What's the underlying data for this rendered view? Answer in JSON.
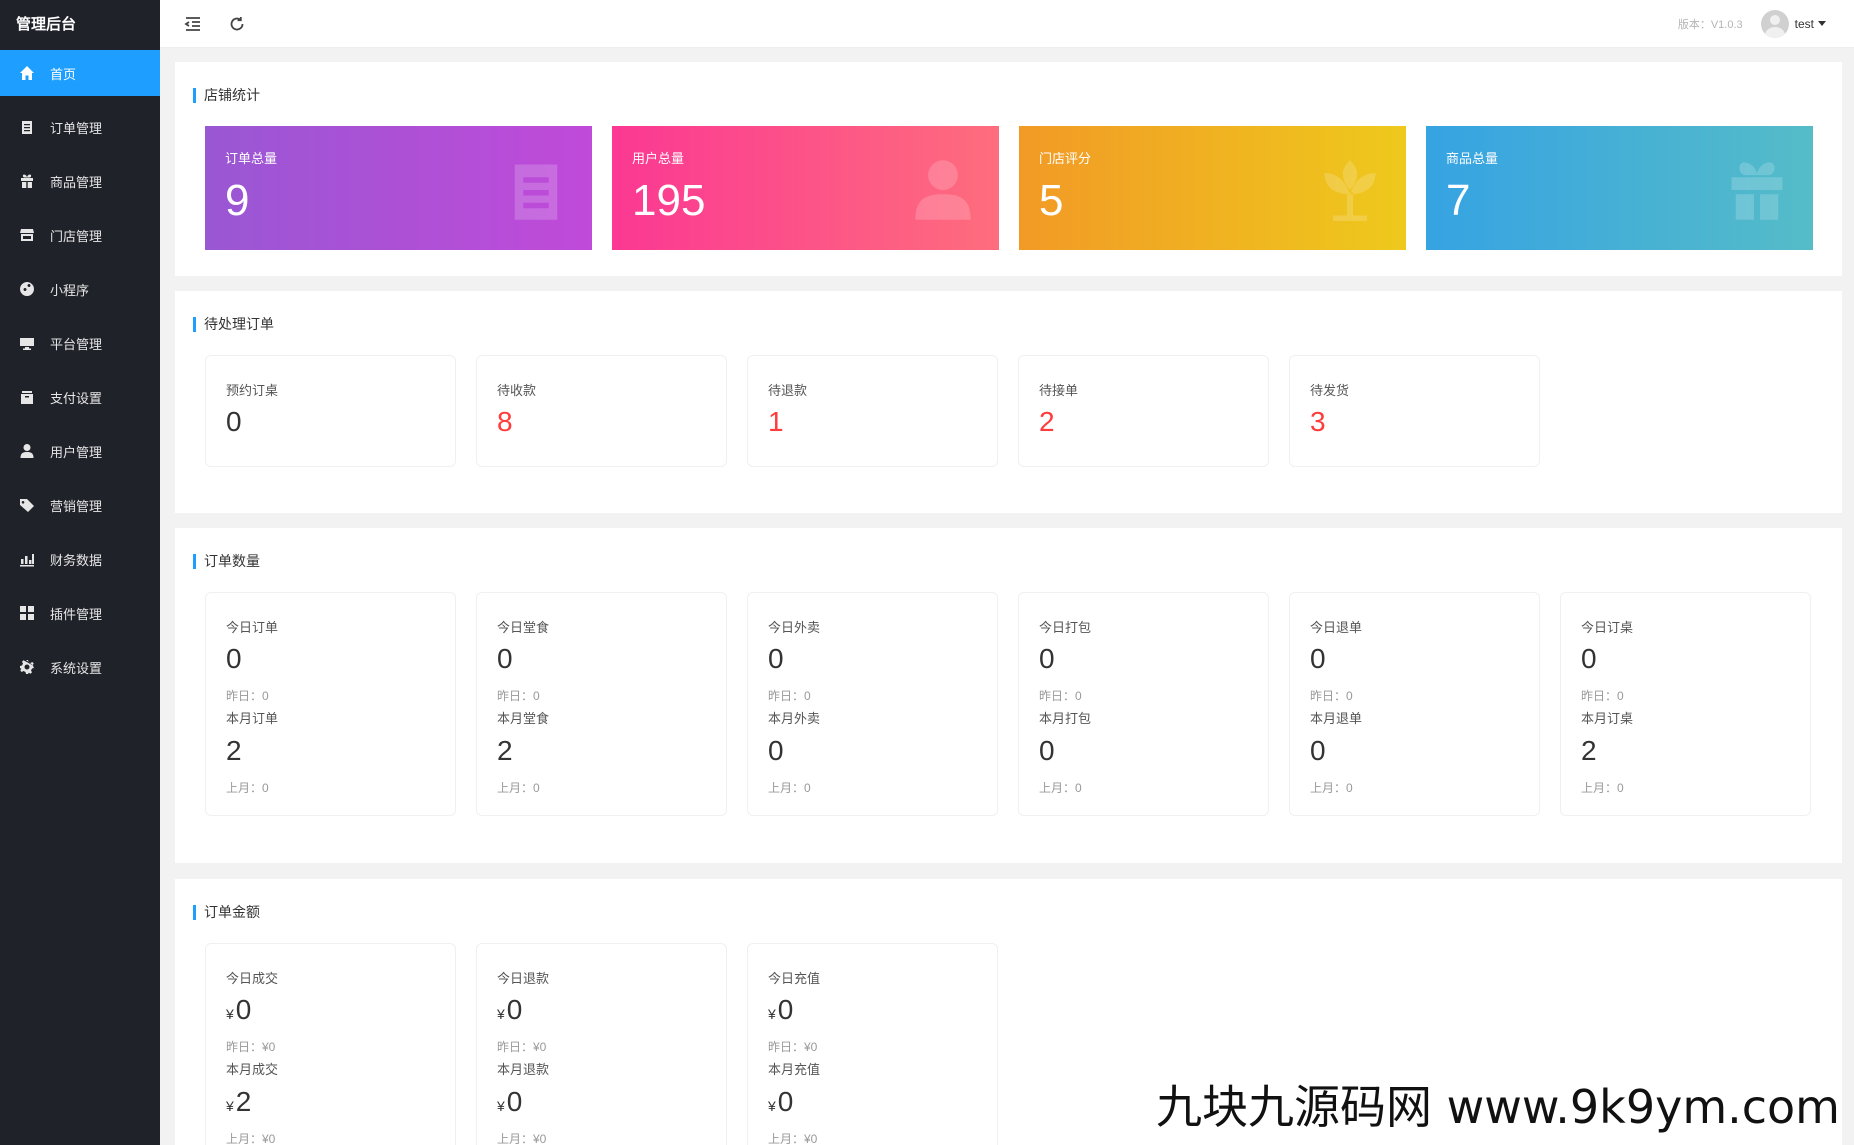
{
  "app": {
    "title": "管理后台"
  },
  "sidebar": {
    "items": [
      {
        "label": "首页",
        "icon": "home-icon",
        "active": true
      },
      {
        "label": "订单管理",
        "icon": "clipboard-icon"
      },
      {
        "label": "商品管理",
        "icon": "gift-icon"
      },
      {
        "label": "门店管理",
        "icon": "store-icon"
      },
      {
        "label": "小程序",
        "icon": "mini-program-icon"
      },
      {
        "label": "平台管理",
        "icon": "monitor-icon"
      },
      {
        "label": "支付设置",
        "icon": "wallet-icon"
      },
      {
        "label": "用户管理",
        "icon": "user-icon"
      },
      {
        "label": "营销管理",
        "icon": "tag-icon"
      },
      {
        "label": "财务数据",
        "icon": "bar-chart-icon"
      },
      {
        "label": "插件管理",
        "icon": "grid-icon"
      },
      {
        "label": "系统设置",
        "icon": "gear-icon"
      }
    ]
  },
  "header": {
    "version": "版本：V1.0.3",
    "username": "test"
  },
  "store_stats": {
    "title": "店铺统计",
    "cards": [
      {
        "label": "订单总量",
        "value": "9",
        "icon": "clipboard-icon"
      },
      {
        "label": "用户总量",
        "value": "195",
        "icon": "user-icon"
      },
      {
        "label": "门店评分",
        "value": "5",
        "icon": "flower-icon"
      },
      {
        "label": "商品总量",
        "value": "7",
        "icon": "gift-icon"
      }
    ]
  },
  "pending_orders": {
    "title": "待处理订单",
    "items": [
      {
        "label": "预约订桌",
        "value": "0"
      },
      {
        "label": "待收款",
        "value": "8"
      },
      {
        "label": "待退款",
        "value": "1"
      },
      {
        "label": "待接单",
        "value": "2"
      },
      {
        "label": "待发货",
        "value": "3"
      }
    ]
  },
  "order_counts": {
    "title": "订单数量",
    "items": [
      {
        "today_label": "今日订单",
        "today": "0",
        "yesterday": "昨日：0",
        "month_label": "本月订单",
        "month": "2",
        "last_month": "上月：0"
      },
      {
        "today_label": "今日堂食",
        "today": "0",
        "yesterday": "昨日：0",
        "month_label": "本月堂食",
        "month": "2",
        "last_month": "上月：0"
      },
      {
        "today_label": "今日外卖",
        "today": "0",
        "yesterday": "昨日：0",
        "month_label": "本月外卖",
        "month": "0",
        "last_month": "上月：0"
      },
      {
        "today_label": "今日打包",
        "today": "0",
        "yesterday": "昨日：0",
        "month_label": "本月打包",
        "month": "0",
        "last_month": "上月：0"
      },
      {
        "today_label": "今日退单",
        "today": "0",
        "yesterday": "昨日：0",
        "month_label": "本月退单",
        "month": "0",
        "last_month": "上月：0"
      },
      {
        "today_label": "今日订桌",
        "today": "0",
        "yesterday": "昨日：0",
        "month_label": "本月订桌",
        "month": "2",
        "last_month": "上月：0"
      }
    ]
  },
  "order_amounts": {
    "title": "订单金额",
    "currency": "¥",
    "items": [
      {
        "today_label": "今日成交",
        "today": "0",
        "yesterday": "昨日：¥0",
        "month_label": "本月成交",
        "month": "2",
        "last_month": "上月：¥0"
      },
      {
        "today_label": "今日退款",
        "today": "0",
        "yesterday": "昨日：¥0",
        "month_label": "本月退款",
        "month": "0",
        "last_month": "上月：¥0"
      },
      {
        "today_label": "今日充值",
        "today": "0",
        "yesterday": "昨日：¥0",
        "month_label": "本月充值",
        "month": "0",
        "last_month": "上月：¥0"
      }
    ]
  },
  "watermark": "九块九源码网 www.9k9ym.com"
}
